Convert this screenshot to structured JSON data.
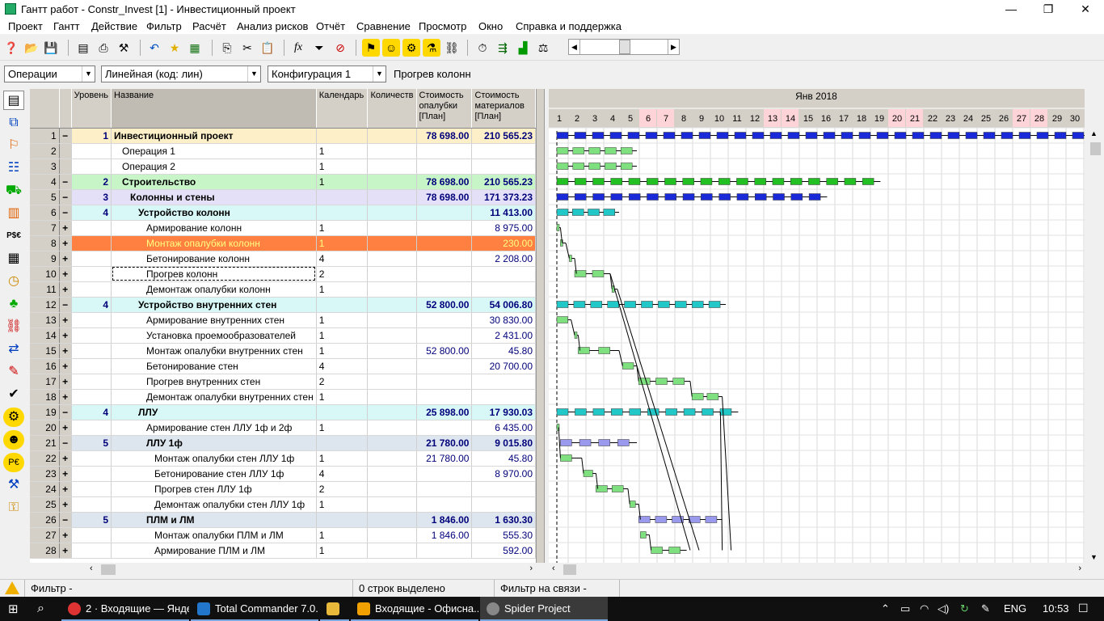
{
  "window": {
    "title": "Гантт работ - Constr_Invest [1] - Инвестиционный проект",
    "minimize": "—",
    "restore": "❐",
    "close": "✕"
  },
  "menu": [
    "Проект",
    "Гантт",
    "Действие",
    "Фильтр",
    "Расчёт",
    "Анализ рисков",
    "Отчёт",
    "Сравнение",
    "Просмотр",
    "Окно",
    "Справка и поддержка"
  ],
  "toolbar": {
    "icons": [
      "help-icon",
      "open-folder-icon",
      "save-icon",
      "table-icon",
      "print-icon",
      "tools-icon",
      "undo-icon",
      "star-icon",
      "excel-icon",
      "copy-icon",
      "cut-icon",
      "paste-icon",
      "formula-icon",
      "filter-icon",
      "clear-filter-icon",
      "person-icon",
      "person-icon",
      "resource-icon",
      "resource-icon",
      "link-icon",
      "calc-icon",
      "calc-icon",
      "calc-icon",
      "calc-icon"
    ]
  },
  "filters": {
    "view": "Операции",
    "structure": "Линейная (код: лин)",
    "config": "Конфигурация 1",
    "selected_name": "Прогрев колонн"
  },
  "columns": {
    "level": "Уровень",
    "name": "Название",
    "calendar": "Календарь",
    "qty": "Количеств",
    "cost": "Стоимость опалубки [План]",
    "material": "Стоимость материалов [План]"
  },
  "rows": [
    {
      "n": "1",
      "ex": "−",
      "lvl": "1",
      "name": "Инвестиционный проект",
      "cal": "",
      "cost": "78 698.00",
      "mat": "210 565.23",
      "bold": true,
      "bg": "#fdf0c9",
      "ind": 0
    },
    {
      "n": "2",
      "ex": "",
      "lvl": "",
      "name": "Операция 1",
      "cal": "1",
      "cost": "",
      "mat": "",
      "bold": false,
      "bg": "#ffffff",
      "ind": 10
    },
    {
      "n": "3",
      "ex": "",
      "lvl": "",
      "name": "Операция 2",
      "cal": "1",
      "cost": "",
      "mat": "",
      "bold": false,
      "bg": "#ffffff",
      "ind": 10
    },
    {
      "n": "4",
      "ex": "−",
      "lvl": "2",
      "name": "Строительство",
      "cal": "1",
      "cost": "78 698.00",
      "mat": "210 565.23",
      "bold": true,
      "bg": "#c8f5c8",
      "ind": 10
    },
    {
      "n": "5",
      "ex": "−",
      "lvl": "3",
      "name": "Колонны и стены",
      "cal": "",
      "cost": "78 698.00",
      "mat": "171 373.23",
      "bold": true,
      "bg": "#e4e0f8",
      "ind": 20
    },
    {
      "n": "6",
      "ex": "−",
      "lvl": "4",
      "name": "Устройство колонн",
      "cal": "",
      "cost": "",
      "mat": "11 413.00",
      "bold": true,
      "bg": "#d8f8f8",
      "ind": 30
    },
    {
      "n": "7",
      "ex": "+",
      "lvl": "",
      "name": "Армирование колонн",
      "cal": "1",
      "cost": "",
      "mat": "8 975.00",
      "bold": false,
      "bg": "#ffffff",
      "ind": 40
    },
    {
      "n": "8",
      "ex": "+",
      "lvl": "",
      "name": "Монтаж  опалубки колонн",
      "cal": "1",
      "cost": "",
      "mat": "230.00",
      "bold": false,
      "bg": "#ff8040",
      "ind": 40,
      "sel": true
    },
    {
      "n": "9",
      "ex": "+",
      "lvl": "",
      "name": "Бетонирование колонн",
      "cal": "4",
      "cost": "",
      "mat": "2 208.00",
      "bold": false,
      "bg": "#ffffff",
      "ind": 40
    },
    {
      "n": "10",
      "ex": "+",
      "lvl": "",
      "name": "Прогрев колонн",
      "cal": "2",
      "cost": "",
      "mat": "",
      "bold": false,
      "bg": "#ffffff",
      "ind": 40,
      "focus": true
    },
    {
      "n": "11",
      "ex": "+",
      "lvl": "",
      "name": "Демонтаж опалубки колонн",
      "cal": "1",
      "cost": "",
      "mat": "",
      "bold": false,
      "bg": "#ffffff",
      "ind": 40
    },
    {
      "n": "12",
      "ex": "−",
      "lvl": "4",
      "name": "Устройство внутренних стен",
      "cal": "",
      "cost": "52 800.00",
      "mat": "54 006.80",
      "bold": true,
      "bg": "#d8f8f8",
      "ind": 30
    },
    {
      "n": "13",
      "ex": "+",
      "lvl": "",
      "name": "Армирование внутренних стен",
      "cal": "1",
      "cost": "",
      "mat": "30 830.00",
      "bold": false,
      "bg": "#ffffff",
      "ind": 40
    },
    {
      "n": "14",
      "ex": "+",
      "lvl": "",
      "name": "Установка проемообразователей",
      "cal": "1",
      "cost": "",
      "mat": "2 431.00",
      "bold": false,
      "bg": "#ffffff",
      "ind": 40
    },
    {
      "n": "15",
      "ex": "+",
      "lvl": "",
      "name": "Монтаж опалубки внутренних стен",
      "cal": "1",
      "cost": "52 800.00",
      "mat": "45.80",
      "bold": false,
      "bg": "#ffffff",
      "ind": 40
    },
    {
      "n": "16",
      "ex": "+",
      "lvl": "",
      "name": "Бетонирование стен",
      "cal": "4",
      "cost": "",
      "mat": "20 700.00",
      "bold": false,
      "bg": "#ffffff",
      "ind": 40
    },
    {
      "n": "17",
      "ex": "+",
      "lvl": "",
      "name": "Прогрев внутренних стен",
      "cal": "2",
      "cost": "",
      "mat": "",
      "bold": false,
      "bg": "#ffffff",
      "ind": 40
    },
    {
      "n": "18",
      "ex": "+",
      "lvl": "",
      "name": "Демонтаж опалубки внутренних стен",
      "cal": "1",
      "cost": "",
      "mat": "",
      "bold": false,
      "bg": "#ffffff",
      "ind": 40
    },
    {
      "n": "19",
      "ex": "−",
      "lvl": "4",
      "name": "ЛЛУ",
      "cal": "",
      "cost": "25 898.00",
      "mat": "17 930.03",
      "bold": true,
      "bg": "#d8f8f8",
      "ind": 30
    },
    {
      "n": "20",
      "ex": "+",
      "lvl": "",
      "name": "Армирование стен ЛЛУ 1ф и 2ф",
      "cal": "1",
      "cost": "",
      "mat": "6 435.00",
      "bold": false,
      "bg": "#ffffff",
      "ind": 40
    },
    {
      "n": "21",
      "ex": "−",
      "lvl": "5",
      "name": "ЛЛУ 1ф",
      "cal": "",
      "cost": "21 780.00",
      "mat": "9 015.80",
      "bold": true,
      "bg": "#dde6ee",
      "ind": 40
    },
    {
      "n": "22",
      "ex": "+",
      "lvl": "",
      "name": "Монтаж опалубки стен ЛЛУ 1ф",
      "cal": "1",
      "cost": "21 780.00",
      "mat": "45.80",
      "bold": false,
      "bg": "#ffffff",
      "ind": 50
    },
    {
      "n": "23",
      "ex": "+",
      "lvl": "",
      "name": "Бетонирование стен ЛЛУ 1ф",
      "cal": "4",
      "cost": "",
      "mat": "8 970.00",
      "bold": false,
      "bg": "#ffffff",
      "ind": 50
    },
    {
      "n": "24",
      "ex": "+",
      "lvl": "",
      "name": "Прогрев стен ЛЛУ 1ф",
      "cal": "2",
      "cost": "",
      "mat": "",
      "bold": false,
      "bg": "#ffffff",
      "ind": 50
    },
    {
      "n": "25",
      "ex": "+",
      "lvl": "",
      "name": "Демонтаж опалубки стен ЛЛУ 1ф",
      "cal": "1",
      "cost": "",
      "mat": "",
      "bold": false,
      "bg": "#ffffff",
      "ind": 50
    },
    {
      "n": "26",
      "ex": "−",
      "lvl": "5",
      "name": "ПЛМ и ЛМ",
      "cal": "",
      "cost": "1 846.00",
      "mat": "1 630.30",
      "bold": true,
      "bg": "#dde6ee",
      "ind": 40
    },
    {
      "n": "27",
      "ex": "+",
      "lvl": "",
      "name": "Монтаж опалубки ПЛМ и ЛМ",
      "cal": "1",
      "cost": "1 846.00",
      "mat": "555.30",
      "bold": false,
      "bg": "#ffffff",
      "ind": 50
    },
    {
      "n": "28",
      "ex": "+",
      "lvl": "",
      "name": "Армирование ПЛМ и ЛМ",
      "cal": "1",
      "cost": "",
      "mat": "592.00",
      "bold": false,
      "bg": "#ffffff",
      "ind": 50
    }
  ],
  "gantt": {
    "month": "Янв 2018",
    "days": [
      "1",
      "2",
      "3",
      "4",
      "5",
      "6",
      "7",
      "8",
      "9",
      "10",
      "11",
      "12",
      "13",
      "14",
      "15",
      "16",
      "17",
      "18",
      "19",
      "20",
      "21",
      "22",
      "23",
      "24",
      "25",
      "26",
      "27",
      "28",
      "29",
      "30"
    ],
    "weekend": [
      "6",
      "7",
      "13",
      "14",
      "20",
      "21",
      "27",
      "28"
    ],
    "bars": [
      {
        "row": 1,
        "start": 0,
        "end": 30,
        "color": "#1a2ad8"
      },
      {
        "row": 2,
        "start": 0,
        "end": 4.5,
        "color": "#7fe07f"
      },
      {
        "row": 3,
        "start": 0,
        "end": 4.5,
        "color": "#7fe07f"
      },
      {
        "row": 4,
        "start": 0,
        "end": 18.2,
        "color": "#22c022"
      },
      {
        "row": 5,
        "start": 0,
        "end": 15.2,
        "color": "#1a2ad8"
      },
      {
        "row": 6,
        "start": 0,
        "end": 3.5,
        "color": "#22c8c8"
      },
      {
        "row": 7,
        "start": 0,
        "end": 0.2,
        "color": "#7fe07f"
      },
      {
        "row": 8,
        "start": 0.2,
        "end": 0.5,
        "color": "#7fe07f"
      },
      {
        "row": 9,
        "start": 0.7,
        "end": 1,
        "color": "#7fe07f"
      },
      {
        "row": 10,
        "start": 1,
        "end": 3,
        "color": "#7fe07f"
      },
      {
        "row": 11,
        "start": 3.1,
        "end": 3.4,
        "color": "#7fe07f"
      },
      {
        "row": 12,
        "start": 0,
        "end": 9.5,
        "color": "#22c8c8"
      },
      {
        "row": 13,
        "start": 0,
        "end": 0.8,
        "color": "#7fe07f"
      },
      {
        "row": 14,
        "start": 1,
        "end": 1.2,
        "color": "#7fe07f"
      },
      {
        "row": 15,
        "start": 1.2,
        "end": 3.5,
        "color": "#7fe07f"
      },
      {
        "row": 16,
        "start": 3.7,
        "end": 4.5,
        "color": "#7fe07f"
      },
      {
        "row": 17,
        "start": 4.6,
        "end": 7.5,
        "color": "#7fe07f"
      },
      {
        "row": 18,
        "start": 7.6,
        "end": 9.3,
        "color": "#7fe07f"
      },
      {
        "row": 19,
        "start": 0,
        "end": 10.2,
        "color": "#22c8c8"
      },
      {
        "row": 20,
        "start": 0,
        "end": 0.1,
        "color": "#7fe07f"
      },
      {
        "row": 21,
        "start": 0.2,
        "end": 4.5,
        "color": "#9999ee"
      },
      {
        "row": 22,
        "start": 0.2,
        "end": 1.4,
        "color": "#7fe07f"
      },
      {
        "row": 23,
        "start": 1.5,
        "end": 2.2,
        "color": "#7fe07f"
      },
      {
        "row": 24,
        "start": 2.2,
        "end": 4,
        "color": "#7fe07f"
      },
      {
        "row": 25,
        "start": 4.1,
        "end": 4.6,
        "color": "#7fe07f"
      },
      {
        "row": 26,
        "start": 4.6,
        "end": 9.3,
        "color": "#9999ee"
      },
      {
        "row": 27,
        "start": 4.7,
        "end": 5.2,
        "color": "#7fe07f"
      },
      {
        "row": 28,
        "start": 5.3,
        "end": 7.3,
        "color": "#7fe07f"
      }
    ]
  },
  "status": {
    "filter": "Фильтр -",
    "selected": "0 строк выделено",
    "link_filter": "Фильтр на связи -"
  },
  "taskbar": {
    "tasks": [
      "2 · Входящие — Янде...",
      "Total Commander 7.0...",
      "",
      "Входящие - Офисна...",
      "Spider Project"
    ],
    "lang": "ENG",
    "time": "10:53"
  }
}
